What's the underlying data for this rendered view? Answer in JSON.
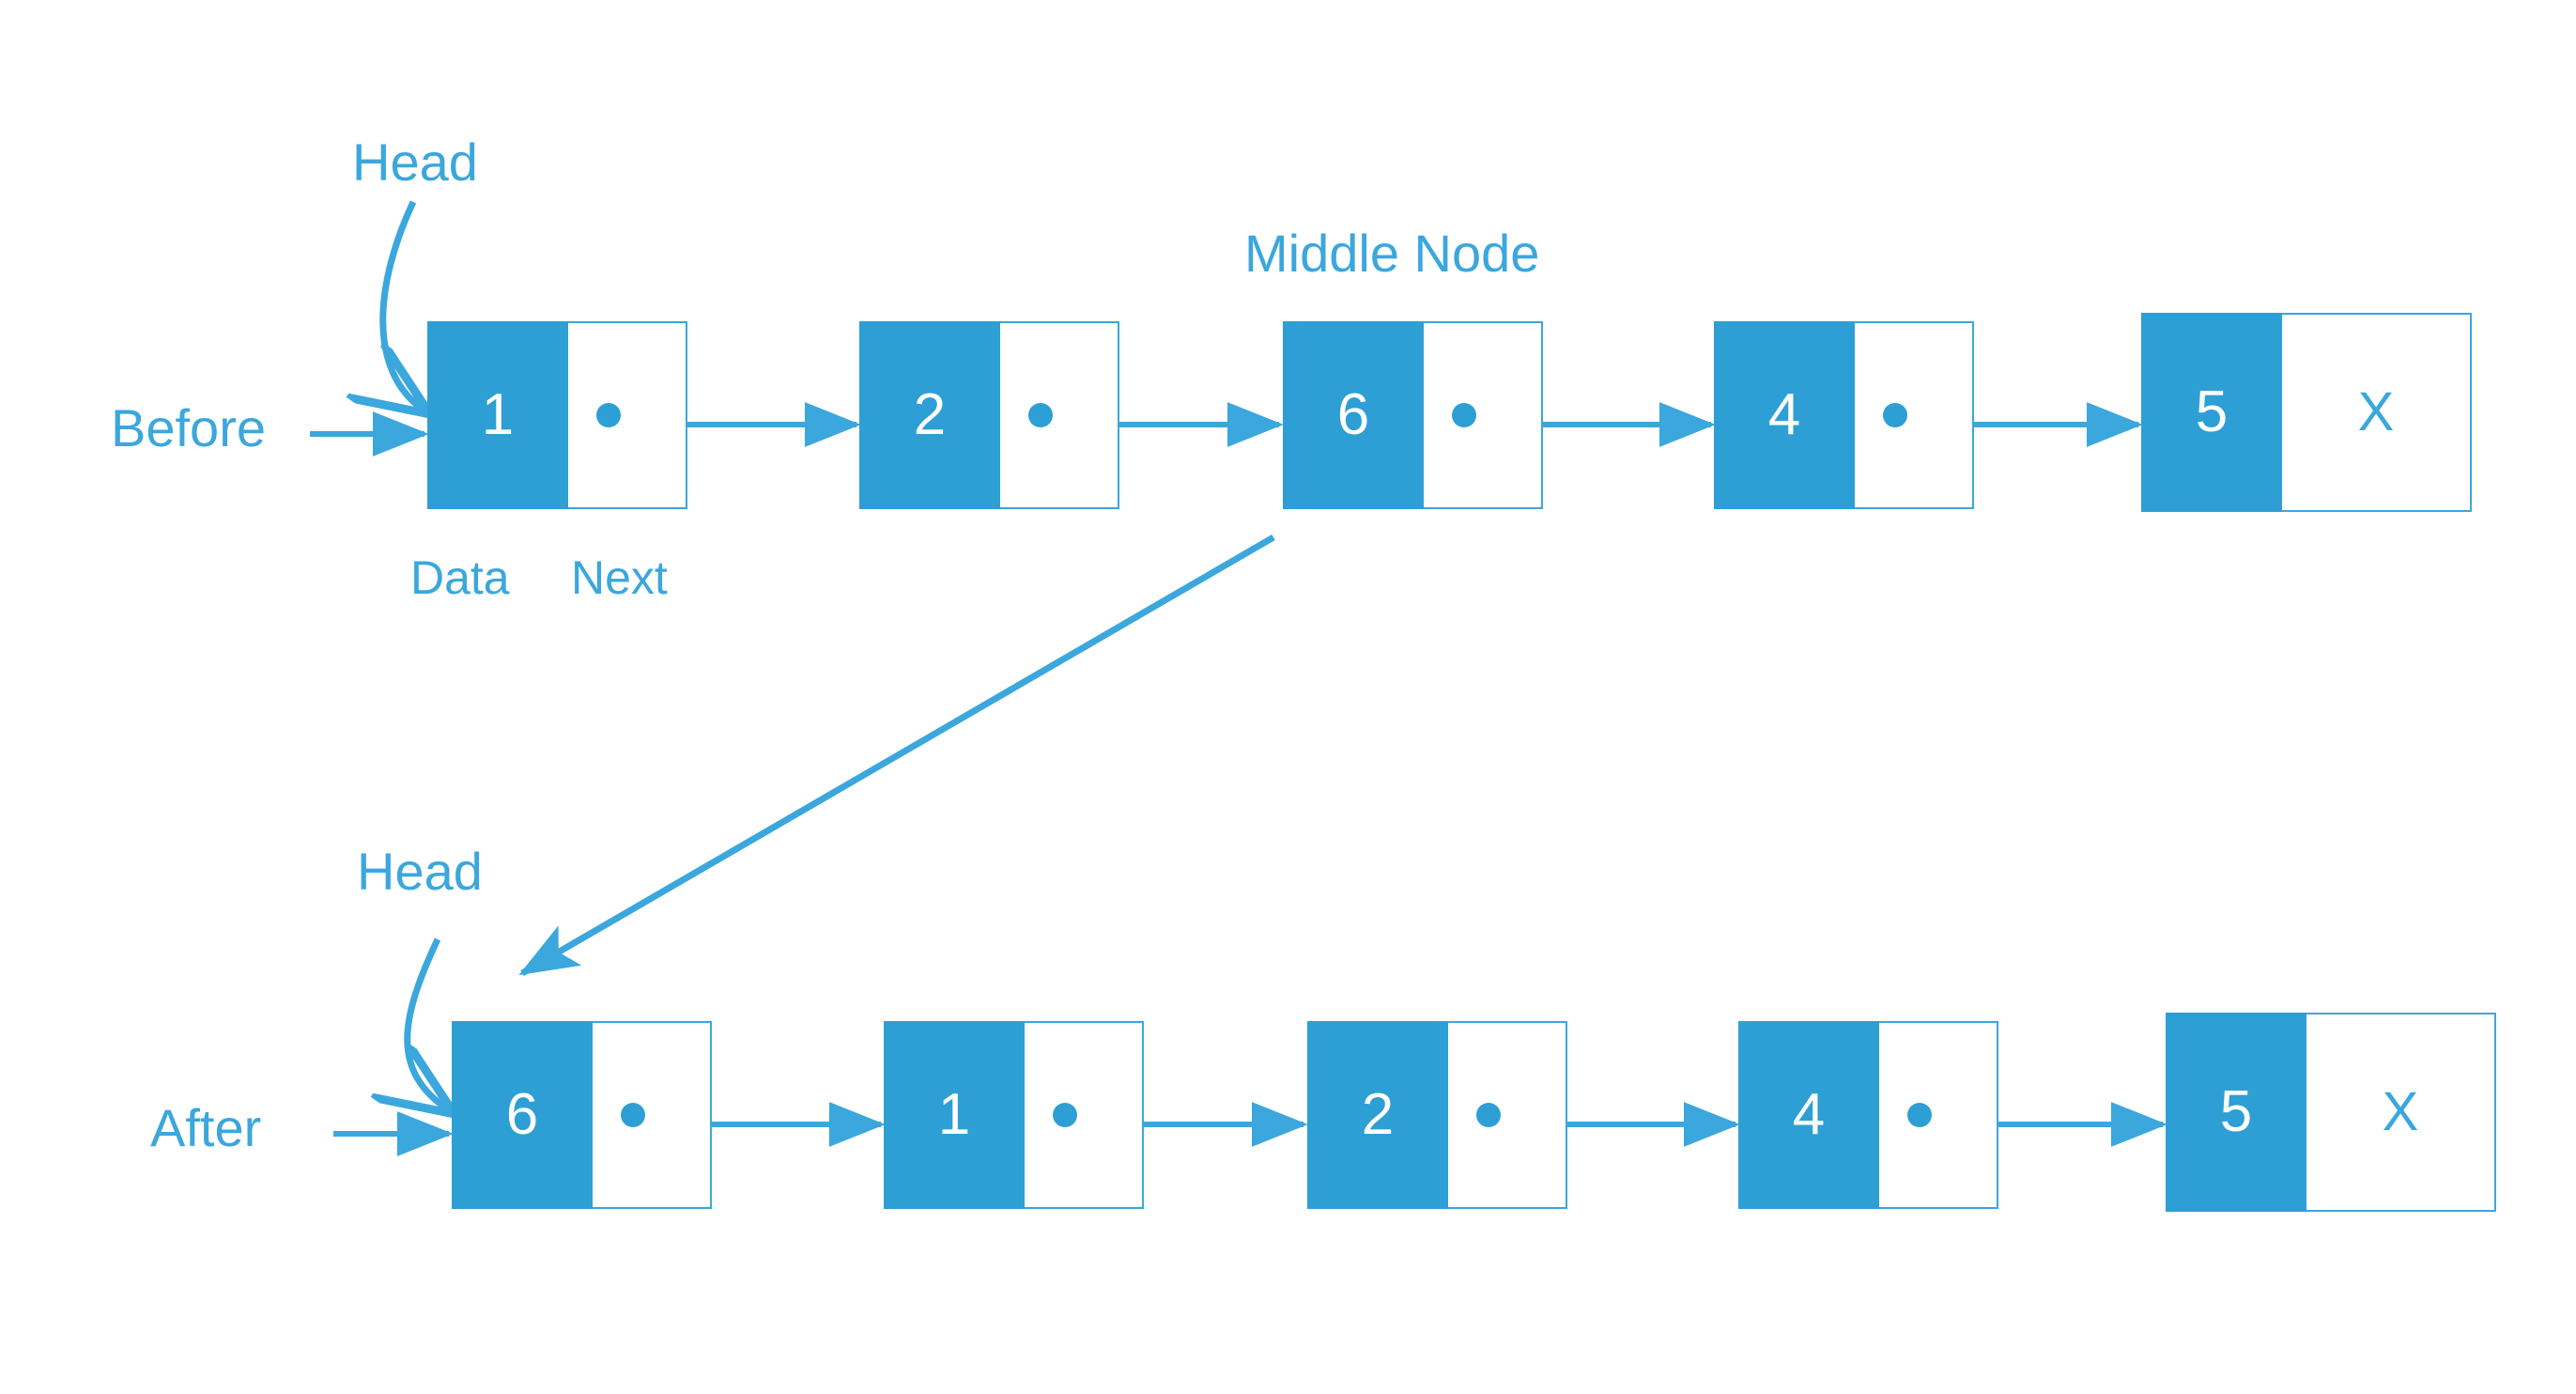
{
  "diagram": {
    "title": "Linked list node move - before and after",
    "accent_color": "#2e9fd4",
    "border_color": "#3ba7dd",
    "background_color": "#ffffff"
  },
  "labels": {
    "head_before": "Head",
    "head_after": "Head",
    "middle_node": "Middle Node",
    "before": "Before",
    "after": "After",
    "data_caption": "Data",
    "next_caption": "Next"
  },
  "rows": [
    {
      "name": "before",
      "row_label": "Before",
      "head_label": "Head",
      "nodes": [
        {
          "data": "1",
          "next": "",
          "terminal": false
        },
        {
          "data": "2",
          "next": "",
          "terminal": false
        },
        {
          "data": "6",
          "next": "",
          "terminal": false
        },
        {
          "data": "4",
          "next": "",
          "terminal": false
        },
        {
          "data": "5",
          "next": "X",
          "terminal": true
        }
      ]
    },
    {
      "name": "after",
      "row_label": "After",
      "head_label": "Head",
      "nodes": [
        {
          "data": "6",
          "next": "",
          "terminal": false
        },
        {
          "data": "1",
          "next": "",
          "terminal": false
        },
        {
          "data": "2",
          "next": "",
          "terminal": false
        },
        {
          "data": "4",
          "next": "",
          "terminal": false
        },
        {
          "data": "5",
          "next": "X",
          "terminal": true
        }
      ]
    }
  ]
}
